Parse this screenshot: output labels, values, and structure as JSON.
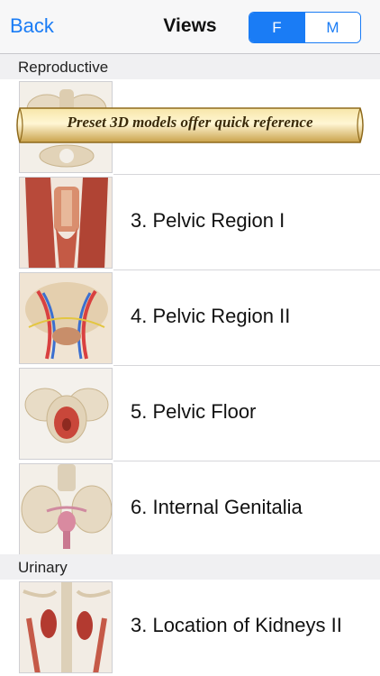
{
  "nav": {
    "back_label": "Back",
    "title": "Views",
    "segments": [
      {
        "label": "F",
        "selected": true
      },
      {
        "label": "M",
        "selected": false
      }
    ],
    "accent_color": "#1a7cf5"
  },
  "banner": {
    "text": "Preset 3D models offer quick reference"
  },
  "sections": [
    {
      "title": "Reproductive",
      "rows": [
        {
          "label": "",
          "thumb": "pelvis-bones-thumbnail"
        },
        {
          "label": "3. Pelvic Region I",
          "thumb": "pelvic-muscles-thumbnail"
        },
        {
          "label": "4. Pelvic Region II",
          "thumb": "pelvic-vessels-thumbnail"
        },
        {
          "label": "5. Pelvic Floor",
          "thumb": "pelvic-floor-thumbnail"
        },
        {
          "label": "6. Internal Genitalia",
          "thumb": "internal-genitalia-thumbnail"
        }
      ]
    },
    {
      "title": "Urinary",
      "rows": [
        {
          "label": "3. Location of Kidneys II",
          "thumb": "kidneys-thumbnail"
        }
      ]
    }
  ]
}
